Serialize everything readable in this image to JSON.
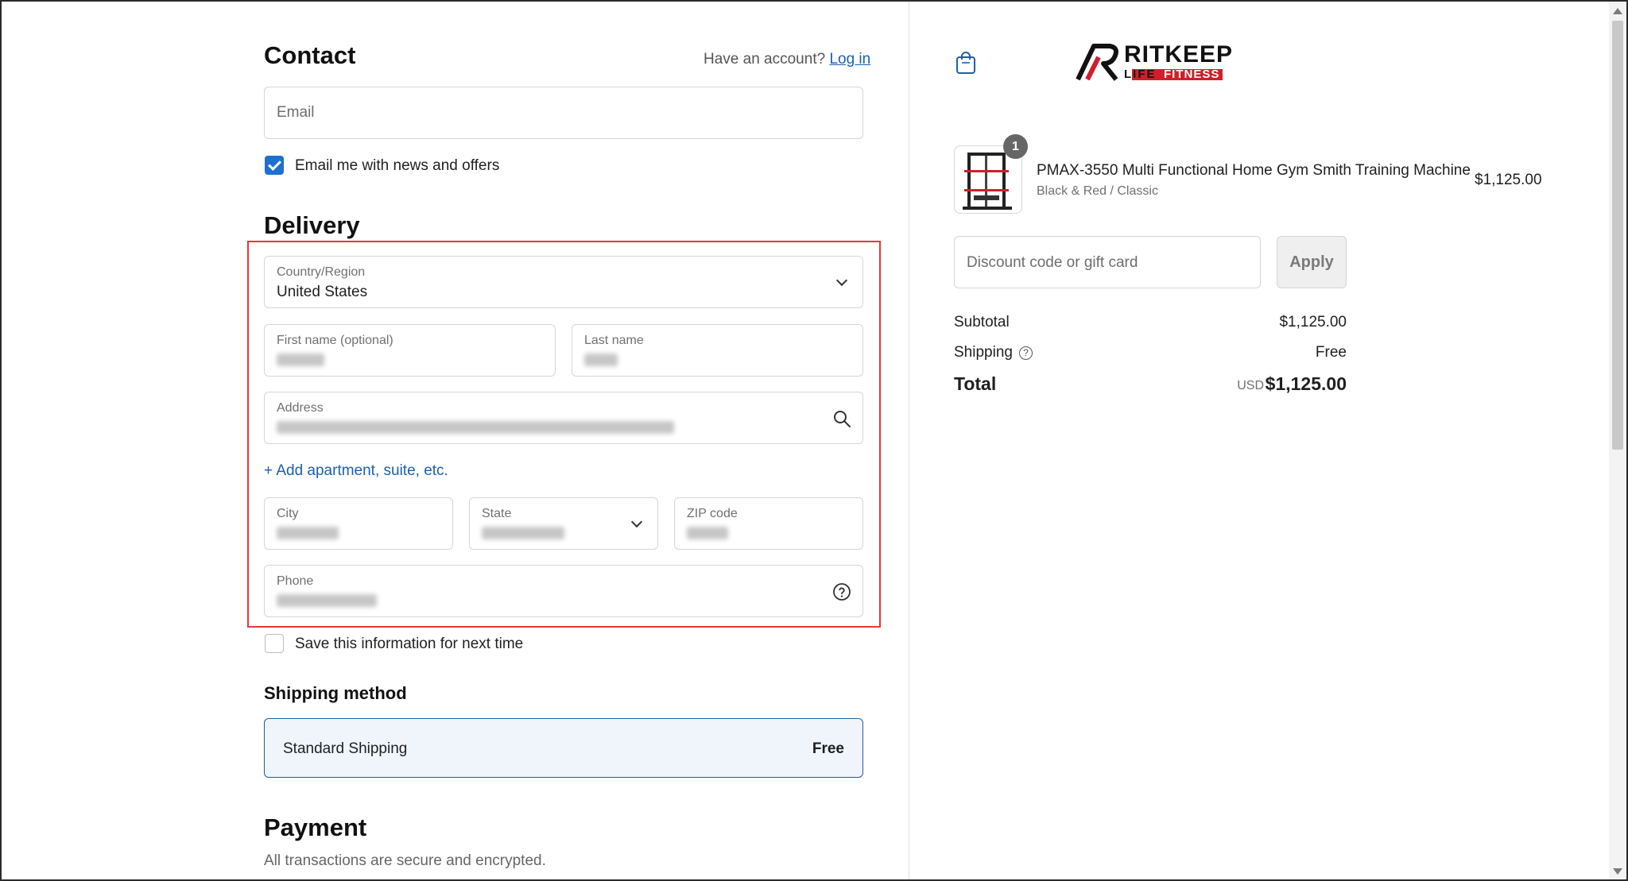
{
  "contact": {
    "title": "Contact",
    "have_account": "Have an account?",
    "login_link": "Log in",
    "email_placeholder": "Email",
    "news_checkbox_label": "Email me with news and offers",
    "news_checked": true
  },
  "delivery": {
    "title": "Delivery",
    "country_label": "Country/Region",
    "country_value": "United States",
    "first_name_label": "First name (optional)",
    "last_name_label": "Last name",
    "address_label": "Address",
    "add_apartment": "+ Add apartment, suite, etc.",
    "city_label": "City",
    "state_label": "State",
    "zip_label": "ZIP code",
    "phone_label": "Phone",
    "save_info_label": "Save this information for next time",
    "save_info_checked": false
  },
  "shipping": {
    "title": "Shipping method",
    "option_name": "Standard Shipping",
    "option_price": "Free"
  },
  "payment": {
    "title": "Payment",
    "note": "All transactions are secure and encrypted."
  },
  "brand": {
    "logo_line1": "RITKEEP",
    "logo_line2": "LIFE",
    "logo_tag": "FITNESS",
    "accent_color": "#d01f2a"
  },
  "order": {
    "quantity": "1",
    "product_name": "PMAX-3550 Multi Functional Home Gym Smith Training Machine",
    "product_variant": "Black & Red / Classic",
    "product_price": "$1,125.00",
    "discount_placeholder": "Discount code or gift card",
    "apply_label": "Apply",
    "subtotal_label": "Subtotal",
    "subtotal_value": "$1,125.00",
    "shipping_label": "Shipping",
    "shipping_value": "Free",
    "total_label": "Total",
    "total_currency": "USD",
    "total_value": "$1,125.00"
  },
  "icons": {
    "bag": "shopping-bag-icon",
    "search": "search-icon",
    "help": "help-circle-icon",
    "chevron": "chevron-down-icon"
  }
}
